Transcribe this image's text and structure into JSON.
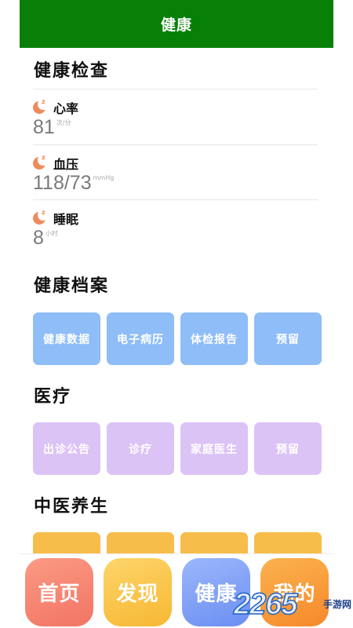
{
  "header": {
    "title": "健康"
  },
  "check": {
    "title": "健康检查",
    "items": [
      {
        "name": "心率",
        "value": "81",
        "unit": "次/分"
      },
      {
        "name": "血压",
        "value": "118/73",
        "unit": "mmHg"
      },
      {
        "name": "睡眠",
        "value": "8",
        "unit": "小时"
      }
    ]
  },
  "records": {
    "title": "健康档案",
    "buttons": [
      "健康数据",
      "电子病历",
      "体检报告",
      "预留"
    ]
  },
  "medical": {
    "title": "医疗",
    "buttons": [
      "出诊公告",
      "诊疗",
      "家庭医生",
      "预留"
    ]
  },
  "tcm": {
    "title": "中医养生"
  },
  "tabs": [
    "首页",
    "发现",
    "健康",
    "我的"
  ],
  "watermark": {
    "number": "2265",
    "text": "手游网"
  }
}
